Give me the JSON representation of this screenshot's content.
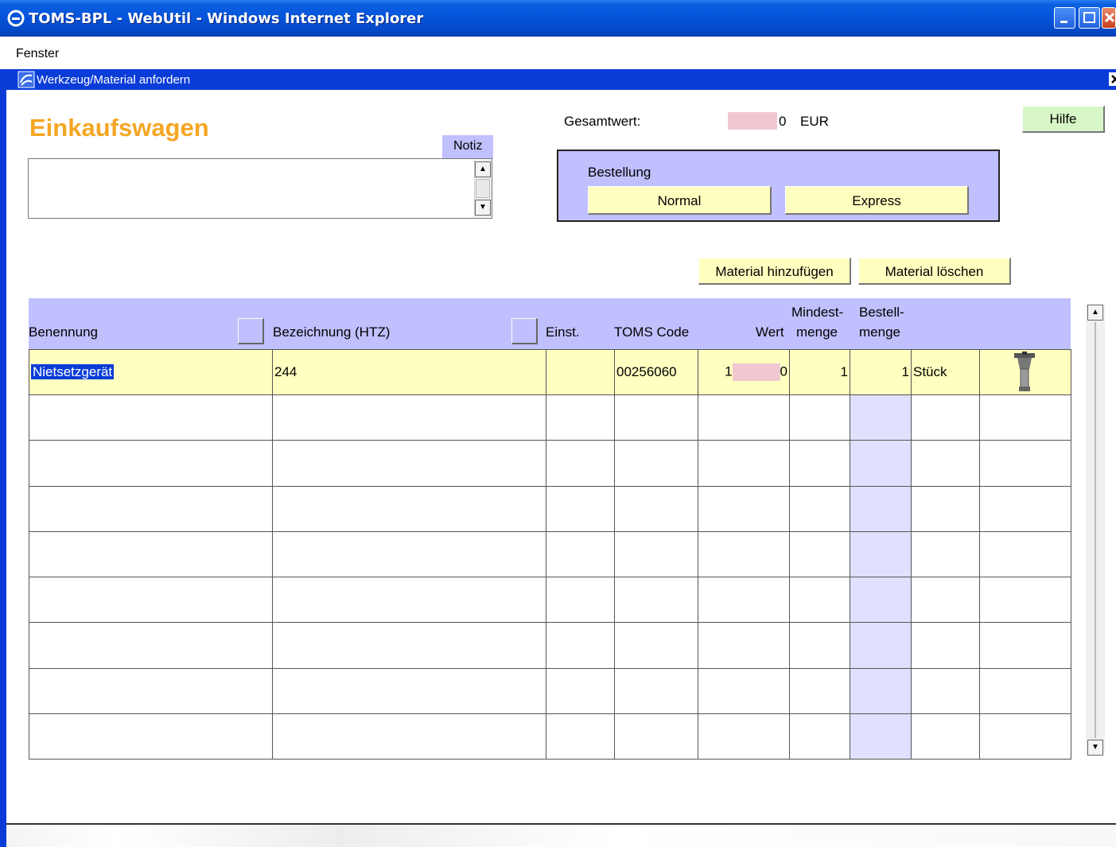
{
  "window": {
    "title": "TOMS-BPL - WebUtil - Windows Internet Explorer",
    "menu": [
      "Fenster"
    ],
    "inner_title": "Werkzeug/Material anfordern"
  },
  "form": {
    "title": "Einkaufswagen",
    "notiz_label": "Notiz",
    "notiz_value": "",
    "gesamtwert_label": "Gesamtwert:",
    "gesamtwert_visible_tail": "0",
    "currency": "EUR",
    "hilfe_label": "Hilfe",
    "bestellung_label": "Bestellung",
    "normal_label": "Normal",
    "express_label": "Express",
    "add_material_label": "Material hinzufügen",
    "delete_material_label": "Material löschen"
  },
  "grid": {
    "headers": {
      "benennung": "Benennung",
      "bezeichnung": "Bezeichnung (HTZ)",
      "einst": "Einst.",
      "toms_code": "TOMS Code",
      "wert": "Wert",
      "mindest_1": "Mindest-",
      "mindest_2": "menge",
      "bestell_1": "Bestell-",
      "bestell_2": "menge"
    },
    "rows": [
      {
        "benennung": "Nietsetzgerät",
        "bezeichnung": "244",
        "einst": "",
        "toms_code": "00256060",
        "wert_visible_lead": "1",
        "wert_visible_tail": "0",
        "mindestmenge": "1",
        "bestellmenge": "1",
        "einheit": "Stück",
        "image": "rivet-tool-icon"
      }
    ],
    "empty_rows": 8
  },
  "colors": {
    "titlebar": "#0553d9",
    "header_bg": "#c0c0ff",
    "button_bg": "#ffffc0",
    "hilfe_bg": "#d7f7c8",
    "title_orange": "#f5a623",
    "redaction": "#f1c8d2"
  }
}
